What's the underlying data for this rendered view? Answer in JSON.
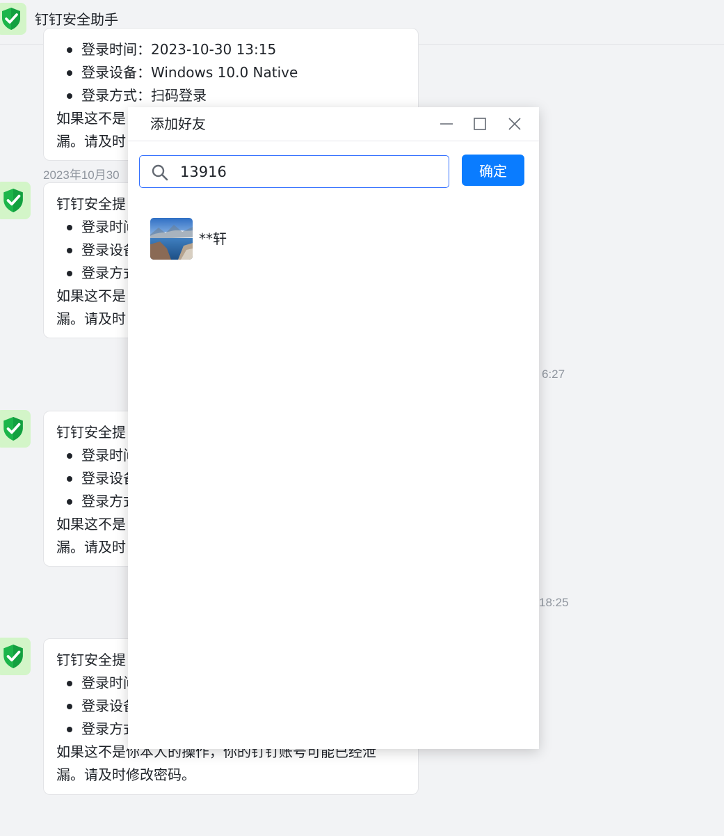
{
  "header": {
    "title": "钉钉安全助手",
    "avatar_icon": "shield-check-icon"
  },
  "colors": {
    "shield_green": "#1cb54a",
    "avatar_bg": "#d3f5c8",
    "primary_blue": "#0a7cff",
    "focus_border": "#3370ff"
  },
  "messages": [
    {
      "items": [
        "登录时间：2023-10-30 13:15",
        "登录设备：Windows 10.0 Native",
        "登录方式：扫码登录"
      ],
      "footer_1": "如果这不是",
      "footer_2": "漏。请及时"
    },
    {
      "timestamp": "2023年10月30",
      "title": "钉钉安全提",
      "items": [
        "登录时间",
        "登录设备",
        "登录方式"
      ],
      "footer_1": "如果这不是",
      "footer_2": "漏。请及时"
    },
    {
      "timestamp_tail": "6:27",
      "title": "钉钉安全提",
      "items": [
        "登录时间",
        "登录设备",
        "登录方式"
      ],
      "footer_1": "如果这不是",
      "footer_2": "漏。请及时"
    },
    {
      "timestamp_tail": "18:25",
      "title": "钉钉安全提",
      "items": [
        "登录时间",
        "登录设备",
        "登录方式"
      ],
      "footer_1": "如果这不是你本人的操作，你的钉钉账号可能已经泄",
      "footer_2": "漏。请及时修改密码。"
    }
  ],
  "dialog": {
    "title": "添加好友",
    "search": {
      "value": "13916",
      "icon": "search-icon"
    },
    "confirm_label": "确定",
    "results": [
      {
        "name": "**轩",
        "avatar": "landscape-photo"
      }
    ],
    "window_controls": [
      "minimize-icon",
      "maximize-icon",
      "close-icon"
    ]
  }
}
